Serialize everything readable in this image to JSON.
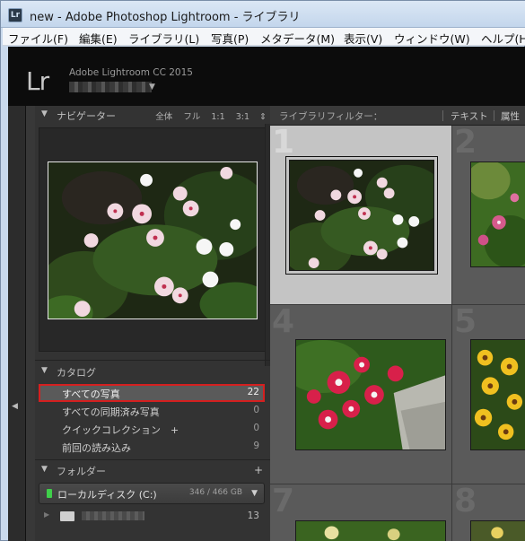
{
  "window": {
    "title": "new - Adobe Photoshop Lightroom - ライブラリ",
    "icon_text": "Lr"
  },
  "menubar": {
    "items": [
      "ファイル(F)",
      "編集(E)",
      "ライブラリ(L)",
      "写真(P)",
      "メタデータ(M)",
      "表示(V)",
      "ウィンドウ(W)",
      "ヘルプ(H)"
    ]
  },
  "identity_plate": {
    "logo": "Lr",
    "product": "Adobe Lightroom CC 2015",
    "dropdown_icon": "triangle-down-icon"
  },
  "navigator": {
    "title": "ナビゲーター",
    "zoom_options": [
      "全体",
      "フル",
      "1:1",
      "3:1"
    ]
  },
  "catalog": {
    "title": "カタログ",
    "items": [
      {
        "label": "すべての写真",
        "count": "22",
        "selected": true
      },
      {
        "label": "すべての同期済み写真",
        "count": "0",
        "selected": false
      },
      {
        "label": "クイックコレクション　+",
        "count": "0",
        "selected": false
      },
      {
        "label": "前回の読み込み",
        "count": "9",
        "selected": false
      }
    ]
  },
  "folders": {
    "title": "フォルダー",
    "add_icon": "plus-icon",
    "volume": {
      "name": "ローカルディスク (C:)",
      "size": "346 / 466 GB"
    },
    "folder_count": "13"
  },
  "filter_bar": {
    "label": "ライブラリフィルター：",
    "text": "テキスト",
    "attribute": "属性"
  },
  "grid": {
    "cell_numbers": [
      "1",
      "2",
      "4",
      "5",
      "7",
      "8"
    ],
    "selected_cell": "1"
  },
  "colors": {
    "selection_outline": "#d42020",
    "disk_indicator": "#3fcf4a",
    "panel_bg": "#333333",
    "grid_bg": "#505050"
  }
}
